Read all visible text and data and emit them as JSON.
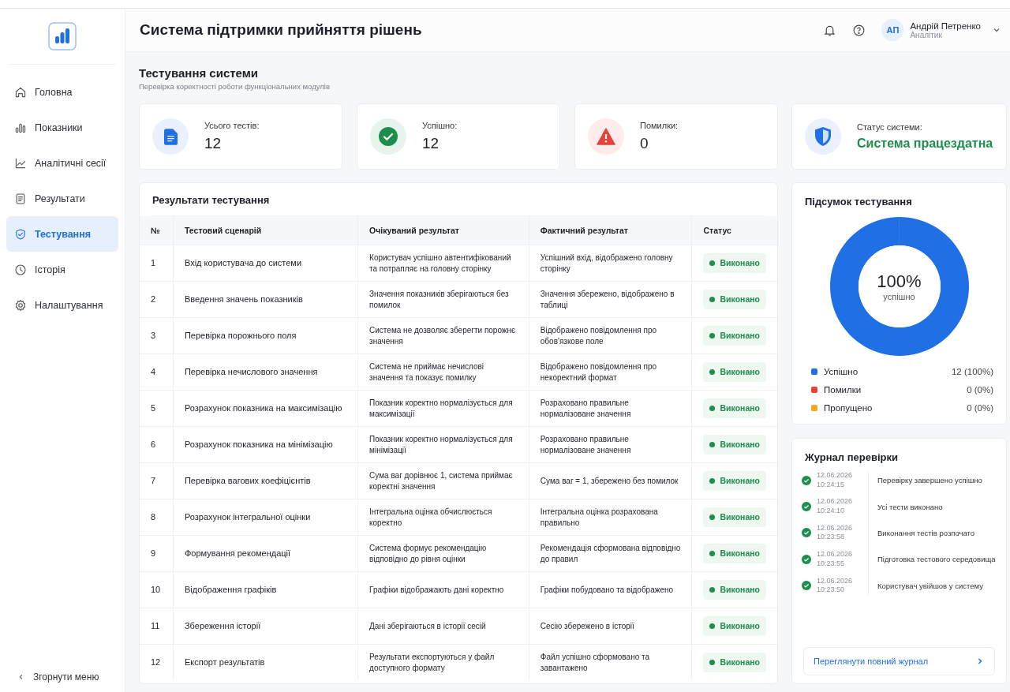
{
  "app": {
    "title": "Система підтримки прийняття рішень"
  },
  "user": {
    "initials": "АП",
    "name": "Андрій Петренко",
    "role": "Аналітик"
  },
  "sidebar": {
    "items": [
      {
        "label": "Головна",
        "kind": "home",
        "selected": false
      },
      {
        "label": "Показники",
        "kind": "bars",
        "selected": false
      },
      {
        "label": "Аналітичні сесії",
        "kind": "trend",
        "selected": false
      },
      {
        "label": "Результати",
        "kind": "doc",
        "selected": false
      },
      {
        "label": "Тестування",
        "kind": "shield",
        "selected": true
      },
      {
        "label": "Історія",
        "kind": "clock",
        "selected": false
      },
      {
        "label": "Налаштування",
        "kind": "gear",
        "selected": false
      }
    ],
    "collapse": "Згорнути меню"
  },
  "page": {
    "title": "Тестування системи",
    "subtitle": "Перевірка коректності роботи функціональних модулів"
  },
  "stats": [
    {
      "kind": "total",
      "label": "Усього тестів:",
      "value": "12"
    },
    {
      "kind": "passed",
      "label": "Успішно:",
      "value": "12"
    },
    {
      "kind": "errors",
      "label": "Помилки:",
      "value": "0"
    },
    {
      "kind": "status",
      "label": "Статус системи:",
      "value": "Система працездатна"
    }
  ],
  "table": {
    "title": "Результати тестування",
    "columns": [
      "№",
      "Тестовий сценарій",
      "Очікуваний результат",
      "Фактичний результат",
      "Статус"
    ],
    "rows": [
      {
        "n": "1",
        "scenario": "Вхід користувача до системи",
        "expected": "Користувач успішно автентифікований та потрапляє на головну сторінку",
        "actual": "Успішний вхід, відображено головну сторінку",
        "status": "Виконано",
        "kind": "done"
      },
      {
        "n": "2",
        "scenario": "Введення значень показників",
        "expected": "Значення показників зберігаються без помилок",
        "actual": "Значення збережено, відображено в таблиці",
        "status": "Виконано",
        "kind": "done"
      },
      {
        "n": "3",
        "scenario": "Перевірка порожнього поля",
        "expected": "Система не дозволяє зберегти порожнє значення",
        "actual": "Відображено повідомлення про обов'язкове поле",
        "status": "Виконано",
        "kind": "done"
      },
      {
        "n": "4",
        "scenario": "Перевірка нечислового значення",
        "expected": "Система не приймає нечислові значення та показує помилку",
        "actual": "Відображено повідомлення про некоректний формат",
        "status": "Виконано",
        "kind": "done"
      },
      {
        "n": "5",
        "scenario": "Розрахунок показника на максимізацію",
        "expected": "Показник коректно нормалізується для максимізації",
        "actual": "Розраховано правильне нормалізоване значення",
        "status": "Виконано",
        "kind": "done"
      },
      {
        "n": "6",
        "scenario": "Розрахунок показника на мінімізацію",
        "expected": "Показник коректно нормалізується для мінімізації",
        "actual": "Розраховано правильне нормалізоване значення",
        "status": "Виконано",
        "kind": "done"
      },
      {
        "n": "7",
        "scenario": "Перевірка вагових коефіцієнтів",
        "expected": "Сума ваг дорівнює 1, система приймає коректні значення",
        "actual": "Сума ваг = 1, збережено без помилок",
        "status": "Виконано",
        "kind": "done"
      },
      {
        "n": "8",
        "scenario": "Розрахунок інтегральної оцінки",
        "expected": "Інтегральна оцінка обчислюється коректно",
        "actual": "Інтегральна оцінка розрахована правильно",
        "status": "Виконано",
        "kind": "done"
      },
      {
        "n": "9",
        "scenario": "Формування рекомендації",
        "expected": "Система формує рекомендацію відповідно до рівня оцінки",
        "actual": "Рекомендація сформована відповідно до правил",
        "status": "Виконано",
        "kind": "done"
      },
      {
        "n": "10",
        "scenario": "Відображення графіків",
        "expected": "Графіки відображають дані коректно",
        "actual": "Графіки побудовано та відображено",
        "status": "Виконано",
        "kind": "done"
      },
      {
        "n": "11",
        "scenario": "Збереження історії",
        "expected": "Дані зберігаються в історії сесій",
        "actual": "Сесію збережено в історії",
        "status": "Виконано",
        "kind": "done"
      },
      {
        "n": "12",
        "scenario": "Експорт результатів",
        "expected": "Результати експортуються у файл доступного формату",
        "actual": "Файл успішно сформовано та завантажено",
        "status": "Виконано",
        "kind": "done"
      }
    ]
  },
  "summary": {
    "title": "Підсумок тестування",
    "center_value": "100%",
    "center_label": "успішно",
    "chart_data": {
      "type": "donut",
      "categories": [
        "Успішно",
        "Помилки",
        "Пропущено"
      ],
      "values": [
        100,
        0,
        0
      ]
    },
    "legend": [
      {
        "value": "12 (100%)",
        "color": "#1f6fe5"
      },
      {
        "value": "0 (0%)",
        "color": "#e5433a"
      },
      {
        "value": "0 (0%)",
        "color": "#f5a623"
      }
    ]
  },
  "log": {
    "title": "Журнал перевірки",
    "entries": [
      {
        "date": "12.06.2026",
        "time": "10:24:15",
        "text": "Перевірку завершено успішно"
      },
      {
        "date": "12.06.2026",
        "time": "10:24:10",
        "text": "Усі тести виконано"
      },
      {
        "date": "12.06.2026",
        "time": "10:23:58",
        "text": "Виконання тестів розпочато"
      },
      {
        "date": "12.06.2026",
        "time": "10:23:55",
        "text": "Підготовка тестового середовища"
      },
      {
        "date": "12.06.2026",
        "time": "10:23:50",
        "text": "Користувач увійшов у систему"
      }
    ],
    "link": "Переглянути повний журнал"
  }
}
